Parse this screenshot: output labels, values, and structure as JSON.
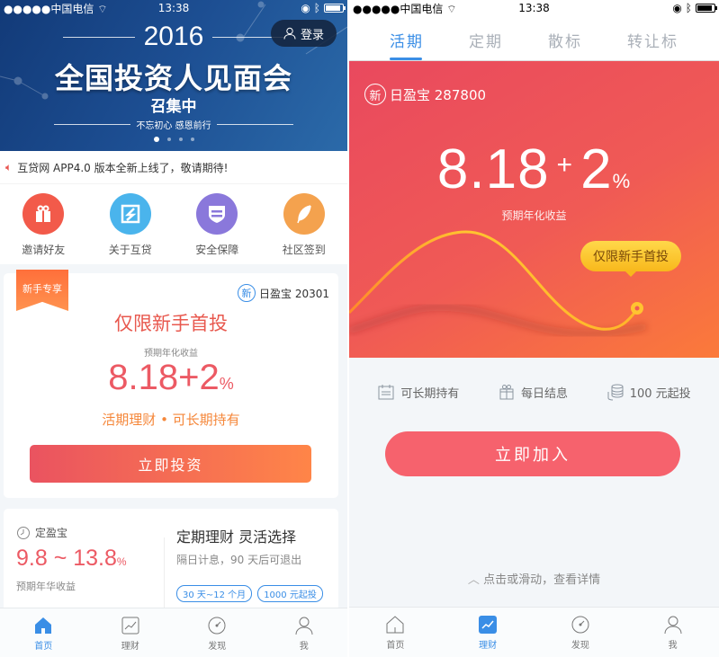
{
  "status_bar": {
    "carrier": "●●●●●中国电信",
    "time": "13:38"
  },
  "left": {
    "banner": {
      "year": "2016",
      "headline": "全国投资人见面会",
      "subline": "召集中",
      "slogan": "不忘初心 感恩前行",
      "login_label": "登录",
      "slide_count": 4,
      "active_slide": 1
    },
    "notice": "互贷网 APP4.0 版本全新上线了，敬请期待!",
    "quick_links": [
      {
        "label": "邀请好友",
        "icon": "gift-icon",
        "color": "#f25a4a"
      },
      {
        "label": "关于互贷",
        "icon": "logo-icon",
        "color": "#4ab4ec"
      },
      {
        "label": "安全保障",
        "icon": "shield-icon",
        "color": "#8a78db"
      },
      {
        "label": "社区签到",
        "icon": "feather-icon",
        "color": "#f4a24e"
      }
    ],
    "newbie_card": {
      "ribbon": "新手专享",
      "badge": "新",
      "product": "日盈宝 20301",
      "title": "仅限新手首投",
      "rate_label": "预期年化收益",
      "rate": "8.18+2",
      "rate_unit": "%",
      "features": "活期理财 • 可长期持有",
      "button": "立即投资"
    },
    "fixed_card": {
      "name": "定盈宝",
      "range": "9.8 ~ 13.8",
      "unit": "%",
      "range_label": "预期年华收益",
      "headline": "定期理财 灵活选择",
      "desc": "隔日计息，90 天后可退出",
      "tags": [
        "30 天~12 个月",
        "1000 元起投"
      ]
    },
    "tabbar": [
      {
        "label": "首页",
        "active": true
      },
      {
        "label": "理财",
        "active": false
      },
      {
        "label": "发现",
        "active": false
      },
      {
        "label": "我",
        "active": false
      }
    ]
  },
  "right": {
    "tabs": [
      {
        "label": "活期",
        "active": true
      },
      {
        "label": "定期",
        "active": false
      },
      {
        "label": "散标",
        "active": false
      },
      {
        "label": "转让标",
        "active": false
      }
    ],
    "hero": {
      "badge": "新",
      "product": "日盈宝 287800",
      "rate_base": "8.18",
      "rate_plus": "+",
      "rate_bonus": "2",
      "rate_unit": "%",
      "rate_label": "预期年化收益",
      "bubble": "仅限新手首投"
    },
    "features": [
      {
        "icon": "calendar-icon",
        "label": "可长期持有"
      },
      {
        "icon": "gift-icon",
        "label": "每日结息"
      },
      {
        "icon": "coins-icon",
        "label": "100 元起投"
      }
    ],
    "join_button": "立即加入",
    "hint": "点击或滑动，查看详情",
    "tabbar": [
      {
        "label": "首页",
        "active": false
      },
      {
        "label": "理财",
        "active": true
      },
      {
        "label": "发现",
        "active": false
      },
      {
        "label": "我",
        "active": false
      }
    ]
  },
  "colors": {
    "accent_blue": "#3a8ee6",
    "accent_red": "#ec5a64",
    "accent_orange": "#f5873a"
  }
}
